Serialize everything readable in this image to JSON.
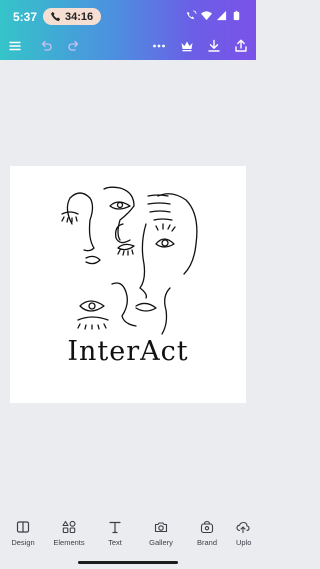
{
  "status_bar": {
    "time": "5:37",
    "call_timer": "34:16"
  },
  "toolbar": {
    "menu_icon": "menu-icon",
    "undo_icon": "undo-icon",
    "redo_icon": "redo-icon",
    "more_icon": "more-icon",
    "premium_icon": "crown-icon",
    "download_icon": "download-icon",
    "share_icon": "share-icon"
  },
  "canvas": {
    "logo_text": "InterAct"
  },
  "bottom_nav": {
    "items": [
      {
        "label": "Design",
        "icon": "design-icon"
      },
      {
        "label": "Elements",
        "icon": "elements-icon"
      },
      {
        "label": "Text",
        "icon": "text-icon"
      },
      {
        "label": "Gallery",
        "icon": "camera-icon"
      },
      {
        "label": "Brand",
        "icon": "brand-icon"
      },
      {
        "label": "Uplo",
        "icon": "upload-icon"
      }
    ]
  },
  "colors": {
    "header_gradient_start": "#35c4c9",
    "header_gradient_end": "#7b52e8",
    "canvas_background": "#ebecef",
    "call_pill": "#f6dfd2"
  }
}
